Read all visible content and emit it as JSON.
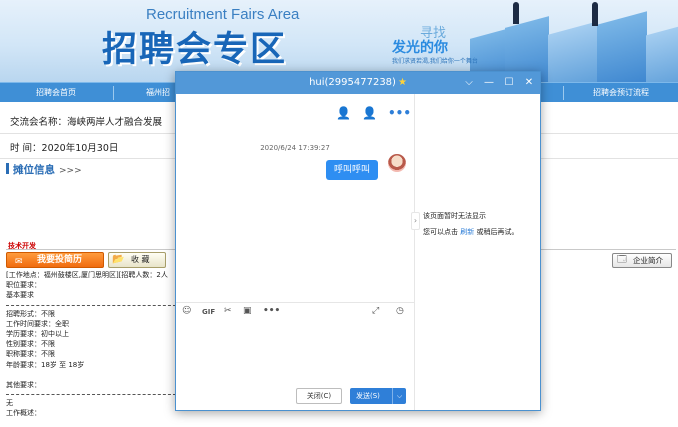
{
  "banner": {
    "title_en": "Recruitment Fairs Area",
    "title_zh": "招聘会专区",
    "slogan_small": "寻找",
    "slogan_big": "发光的你",
    "slogan_sub": "我们求贤若渴,我们给你一个舞台"
  },
  "nav": {
    "items": [
      "招聘会首页",
      "福州招",
      "招聘会预订流程"
    ]
  },
  "fair": {
    "name": "交流会名称：海峡两岸人才融合发展",
    "time": "时 间：2020年10月30日"
  },
  "booth": {
    "label": "摊位信息",
    "arrows": ">>>"
  },
  "job": {
    "title": "技术开发",
    "apply_label": "我要投简历",
    "fav_label": "收 藏",
    "company_label": "企业简介",
    "details": [
      "[工作地点：福州鼓楼区,厦门思明区][招聘人数：2人",
      "职位要求：",
      "基本要求",
      "",
      "招聘形式：不限",
      "工作时间要求：全职",
      "学历要求：初中以上",
      "性别要求：不限",
      "职称要求：不限",
      "年龄要求：18岁 至 18岁",
      "",
      "其他要求：",
      "",
      "无",
      "工作概述："
    ]
  },
  "chat": {
    "window_title": "hui(2995477238)",
    "timestamp": "2020/6/24 17:39:27",
    "message": "呼叫呼叫",
    "close_label": "关闭(C)",
    "send_label": "发送(S)",
    "error_line1": "该页面暂时无法显示",
    "error_line2_prefix": "您可以点击",
    "error_refresh": "刷新",
    "error_line2_suffix": "或稍后再试。"
  }
}
